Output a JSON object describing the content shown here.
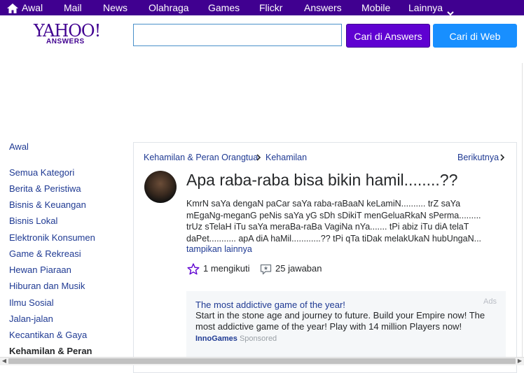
{
  "topnav": {
    "items": [
      {
        "label": "Awal",
        "icon": "home-icon"
      },
      {
        "label": "Mail"
      },
      {
        "label": "News"
      },
      {
        "label": "Olahraga"
      },
      {
        "label": "Games"
      },
      {
        "label": "Flickr"
      },
      {
        "label": "Answers"
      },
      {
        "label": "Mobile"
      },
      {
        "label": "Lainnya",
        "icon": "chevron-down-icon"
      }
    ],
    "color": "#400090"
  },
  "header": {
    "logo_main": "YAHOO!",
    "logo_sub": "ANSWERS",
    "search_value": "",
    "search_placeholder": "",
    "btn_answers": "Cari di Answers",
    "btn_web": "Cari di Web",
    "btn_answers_color": "#5f01d1",
    "btn_web_color": "#188fff"
  },
  "sidebar": {
    "home": "Awal",
    "items": [
      "Semua Kategori",
      "Berita & Peristiwa",
      "Bisnis & Keuangan",
      "Bisnis Lokal",
      "Elektronik Konsumen",
      "Game & Rekreasi",
      "Hewan Piaraan",
      "Hiburan dan Musik",
      "Ilmu Sosial",
      "Jalan-jalan",
      "Kecantikan & Gaya",
      "Kehamilan & Peran"
    ],
    "active": "Kehamilan & Peran"
  },
  "question": {
    "breadcrumb": [
      "Kehamilan & Peran Orangtua",
      "Kehamilan"
    ],
    "next_label": "Berikutnya",
    "title": "Apa raba-raba bisa bikin hamil........??",
    "body_lines": [
      "KmrN saYa dengaN paCar saYa raba-raBaaN keLamiN.......... trZ saYa",
      "mEgaNg-meganG peNis saYa yG sDh sDikiT menGeluaRkaN sPerma.........",
      "trUz sTelaH iTu saYa meraBa-raBa VagiNa nYa....... tPi abiz iTu diA telaT",
      "daPet........... apA diA haMil............?? tPi qTa tiDak melakUkaN hubUngaN..."
    ],
    "more_label": "tampikan lainnya",
    "follow_label": "1 mengikuti",
    "answers_label": "25 jawaban"
  },
  "ad": {
    "label": "Ads",
    "title": "The most addictive game of the year!",
    "description": "Start in the stone age and journey to future. Build your Empire now! The most addictive game of the year! Play with 14 million Players now!",
    "source": "InnoGames",
    "sponsored": "Sponsored"
  }
}
